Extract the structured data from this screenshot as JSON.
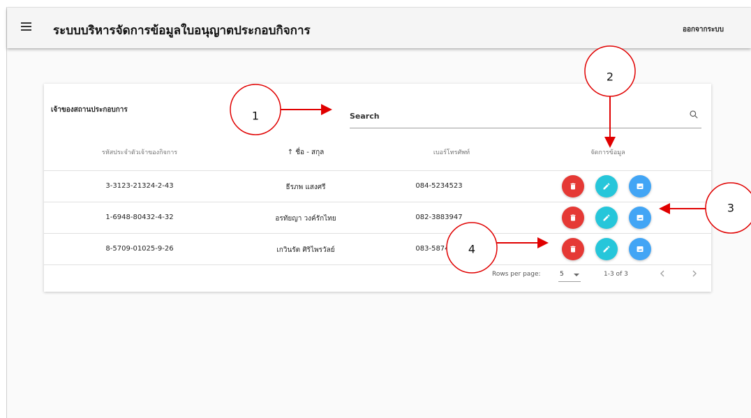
{
  "app": {
    "title": "ระบบบริหารจัดการข้อมูลใบอนุญาตประกอบกิจการ",
    "logout_label": "ออกจากระบบ"
  },
  "card": {
    "title": "เจ้าของสถานประกอบการ",
    "search_placeholder": "Search"
  },
  "table": {
    "headers": {
      "id": "รหัสประจำตัวเจ้าของกิจการ",
      "name": "ชื่อ - สกุล",
      "phone": "เบอร์โทรศัพท์",
      "manage": "จัดการข้อมูล"
    },
    "sort_arrow": "↑",
    "rows": [
      {
        "id": "3-3123-21324-2-43",
        "name": "ธีรภพ แสงศรี",
        "phone": "084-5234523"
      },
      {
        "id": "1-6948-80432-4-32",
        "name": "อรทัยญา วงค์รักไทย",
        "phone": "082-3883947"
      },
      {
        "id": "8-5709-01025-9-26",
        "name": "เกวินรัต ศิริไพรวัลย์",
        "phone": "083-5874443"
      }
    ]
  },
  "pagination": {
    "rows_per_page_label": "Rows per page:",
    "rows_per_page_value": "5",
    "range": "1-3 of 3"
  },
  "annotations": [
    "1",
    "2",
    "3",
    "4"
  ],
  "colors": {
    "delete": "#e53935",
    "edit": "#26c6da",
    "view": "#42a5f5",
    "annotation_arrow": "#e00000"
  }
}
